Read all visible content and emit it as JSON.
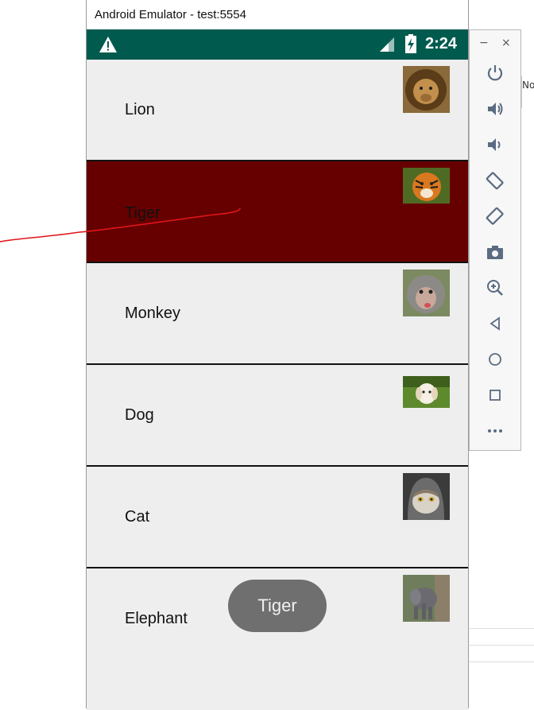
{
  "window": {
    "title": "Android Emulator - test:5554"
  },
  "status_bar": {
    "time": "2:24",
    "color": "#005b4e"
  },
  "list": {
    "items": [
      {
        "label": "Lion",
        "image": "lion-photo"
      },
      {
        "label": "Tiger",
        "image": "tiger-photo",
        "selected": true
      },
      {
        "label": "Monkey",
        "image": "monkey-photo"
      },
      {
        "label": "Dog",
        "image": "dog-photo"
      },
      {
        "label": "Cat",
        "image": "cat-photo"
      },
      {
        "label": "Elephant",
        "image": "elephant-photo"
      }
    ],
    "selected_color": "#660000"
  },
  "toast": {
    "text": "Tiger"
  },
  "toolbar": {
    "minimize": "−",
    "close": "×",
    "buttons": [
      "power-icon",
      "volume-up-icon",
      "volume-down-icon",
      "rotate-left-icon",
      "rotate-right-icon",
      "camera-icon",
      "zoom-icon",
      "back-icon",
      "home-icon",
      "overview-icon",
      "more-icon"
    ]
  },
  "background": {
    "side_text": "No"
  }
}
